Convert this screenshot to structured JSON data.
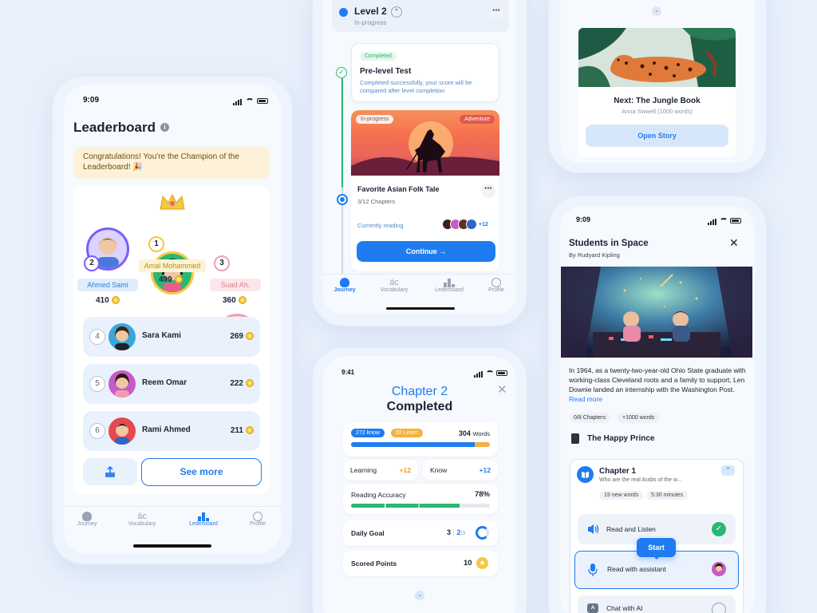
{
  "leaderboard": {
    "time": "9:09",
    "title": "Leaderboard",
    "banner": "Congratulations! You're the Champion of the Leaderboard! 🎉",
    "podium": [
      {
        "rank": "2",
        "name": "Ahmed Sami",
        "score": "410"
      },
      {
        "rank": "1",
        "name": "Amal Mohammed",
        "score": "499"
      },
      {
        "rank": "3",
        "name": "Suad Ah.",
        "score": "360"
      }
    ],
    "list": [
      {
        "rank": "4",
        "name": "Sara Kami",
        "score": "269"
      },
      {
        "rank": "5",
        "name": "Reem Omar",
        "score": "222"
      },
      {
        "rank": "6",
        "name": "Rami Ahmed",
        "score": "211"
      }
    ],
    "see_more": "See more",
    "nav": [
      "Journey",
      "Vocabulary",
      "Lederboard",
      "Profile"
    ]
  },
  "journey": {
    "level": "Level 2",
    "level_status": "In-progress",
    "test_tag": "Completed",
    "test_title": "Pre-level Test",
    "test_desc": "Completed successfully, your score will be compared after level completion",
    "story_status": "In-progress",
    "story_genre": "Adventure",
    "story_title": "Favorite Asian Folk Tale",
    "story_chapters": "3/12 Chapters",
    "story_reading": "Currently reading",
    "readers_more": "+12",
    "continue": "Continue →",
    "nav": [
      "Journey",
      "Vocabulary",
      "Lederboard",
      "Profile"
    ]
  },
  "next_story": {
    "title": "Next: The Jungle Book",
    "author": "Anna Swwell (1000 words)",
    "button": "Open Story"
  },
  "chapter": {
    "time": "9:41",
    "line1": "Chapter 2",
    "line2": "Completed",
    "know_tag": "272 know",
    "learn_tag": "32 Learn",
    "words_num": "304",
    "words_label": "Words",
    "know_ratio": 0.89,
    "learning_label": "Learning",
    "learning_val": "+12",
    "know_label": "Know",
    "know_val": "+12",
    "accuracy_label": "Reading Accuracy",
    "accuracy_val": "78%",
    "accuracy_ratio": 0.78,
    "goal_label": "Daily Goal",
    "goal_a": "3",
    "goal_sep": "|",
    "goal_b": "2",
    "goal_c": "/3",
    "points_label": "Scored Points",
    "points_val": "10"
  },
  "reader": {
    "time": "9:09",
    "title": "Students in Space",
    "author": "By Rudyard Kipling",
    "excerpt": "In 1964, as a twenty-two-year-old Ohio State graduate with working-class Cleveland roots and a family to support, Len Downie landed an internship with the Washington Post.",
    "read_more": "Read more",
    "tag1": "0/8 Chapters",
    "tag2": "+1000 words",
    "book": "The Happy Prince",
    "chapter_title": "Chapter 1",
    "chapter_sub": "Who are the real Arabs of the w...",
    "chapter_words": "19 new words",
    "chapter_time": "5:30 minutes",
    "task1": "Read and Listen",
    "task2": "Read with assistant",
    "task3": "Chat with AI",
    "start": "Start"
  },
  "colors": {
    "accent": "#1f7cf0",
    "gold": "#f5c842",
    "green": "#2bb673",
    "purple": "#7c5cff"
  }
}
